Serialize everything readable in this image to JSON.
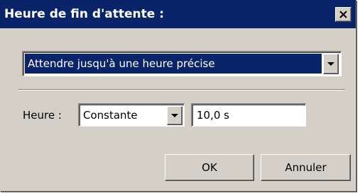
{
  "dialog": {
    "title": "Heure de fin d'attente :",
    "close_icon": "close-x-icon",
    "title_bar_color": "#0a246a",
    "body_color": "#d4d0c8"
  },
  "mode_combo": {
    "value": "Attendre jusqu'à une heure précise",
    "selected_bg": "#0a246a",
    "icon": "chevron-down-icon"
  },
  "time_row": {
    "label": "Heure :",
    "type_combo_value": "Constante",
    "value_field": "10,0 s"
  },
  "buttons": {
    "ok_label": "OK",
    "cancel_label": "Annuler"
  }
}
